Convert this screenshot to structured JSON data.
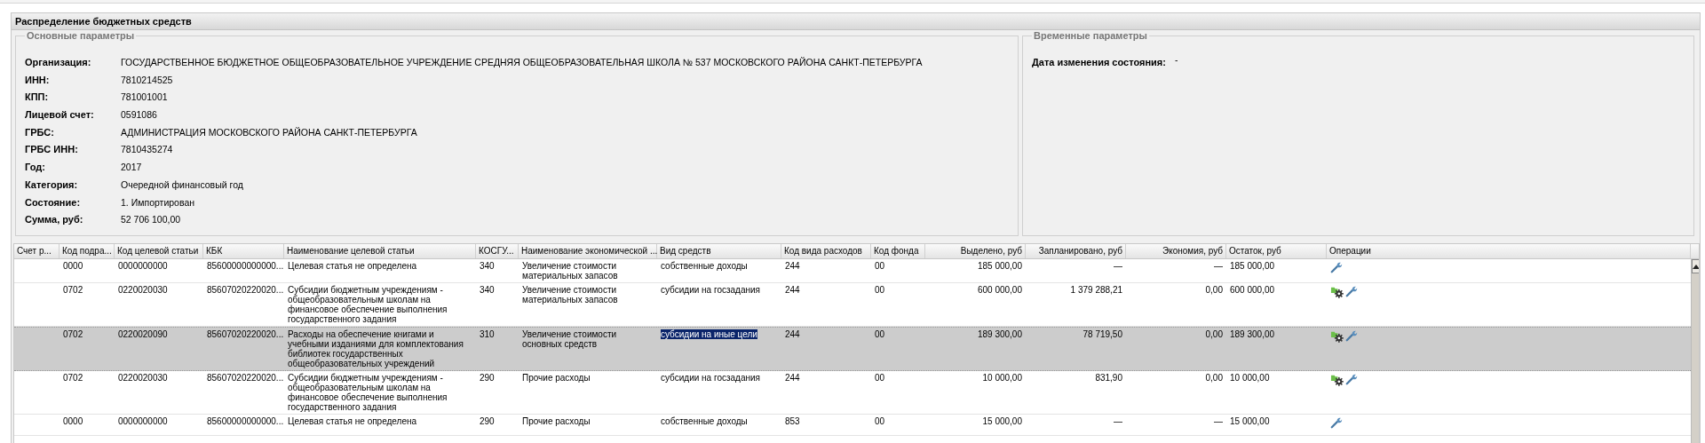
{
  "panel": {
    "title": "Распределение бюджетных средств"
  },
  "main_params": {
    "legend": "Основные параметры",
    "fields": [
      {
        "label": "Организация:",
        "value": "ГОСУДАРСТВЕННОЕ БЮДЖЕТНОЕ ОБЩЕОБРАЗОВАТЕЛЬНОЕ УЧРЕЖДЕНИЕ СРЕДНЯЯ ОБЩЕОБРАЗОВАТЕЛЬНАЯ ШКОЛА № 537 МОСКОВСКОГО РАЙОНА САНКТ-ПЕТЕРБУРГА"
      },
      {
        "label": "ИНН:",
        "value": "7810214525"
      },
      {
        "label": "КПП:",
        "value": "781001001"
      },
      {
        "label": "Лицевой счет:",
        "value": "0591086"
      },
      {
        "label": "ГРБС:",
        "value": "АДМИНИСТРАЦИЯ МОСКОВСКОГО РАЙОНА САНКТ-ПЕТЕРБУРГА"
      },
      {
        "label": "ГРБС ИНН:",
        "value": "7810435274"
      },
      {
        "label": "Год:",
        "value": "2017"
      },
      {
        "label": "Категория:",
        "value": "Очередной финансовый год"
      },
      {
        "label": "Состояние:",
        "value": "1. Импортирован"
      },
      {
        "label": "Сумма, руб:",
        "value": "52 706 100,00"
      }
    ]
  },
  "time_params": {
    "legend": "Временные параметры",
    "fields": [
      {
        "label": "Дата изменения состояния:",
        "value": "-"
      }
    ]
  },
  "table": {
    "columns": [
      "Счет р...",
      "Код подра...",
      "Код целевой статьи",
      "КБК",
      "Наименование целевой статьи",
      "КОСГУ...",
      "Наименование экономической ...",
      "Вид средств",
      "Код вида расходов",
      "Код фонда",
      "Выделено, руб",
      "Запланировано, руб",
      "Экономия, руб",
      "Остаток, руб",
      "Операции"
    ],
    "rows": [
      {
        "selected": false,
        "text_highlighted": false,
        "cells": [
          "",
          "0000",
          "0000000000",
          "85600000000000...",
          "Целевая статья не определена",
          "340",
          "Увеличение стоимости материальных запасов",
          "собственные доходы",
          "244",
          "00",
          "185 000,00",
          "—",
          "—",
          "185 000,00"
        ],
        "operations": [
          {
            "kind": "wrench"
          }
        ]
      },
      {
        "selected": false,
        "text_highlighted": false,
        "cells": [
          "",
          "0702",
          "0220020030",
          "85607020220020...",
          "Субсидии бюджетным учреждениям - общеобразовательным школам на финансовое обеспечение выполнения государственного задания",
          "340",
          "Увеличение стоимости материальных запасов",
          "субсидии на госзадания",
          "244",
          "00",
          "600 000,00",
          "1 379 288,21",
          "0,00",
          "600 000,00"
        ],
        "operations": [
          {
            "kind": "gear"
          },
          {
            "kind": "wrench"
          }
        ]
      },
      {
        "selected": true,
        "text_highlighted": true,
        "cells": [
          "",
          "0702",
          "0220020090",
          "85607020220020...",
          "Расходы на обеспечение книгами и учебными изданиями для комплектования библиотек государственных общеобразовательных учреждений",
          "310",
          "Увеличение стоимости основных средств",
          "субсидии на иные цели",
          "244",
          "00",
          "189 300,00",
          "78 719,50",
          "0,00",
          "189 300,00"
        ],
        "operations": [
          {
            "kind": "gear"
          },
          {
            "kind": "wrench"
          }
        ]
      },
      {
        "selected": false,
        "text_highlighted": false,
        "cells": [
          "",
          "0702",
          "0220020030",
          "85607020220020...",
          "Субсидии бюджетным учреждениям - общеобразовательным школам на финансовое обеспечение выполнения государственного задания",
          "290",
          "Прочие расходы",
          "субсидии на госзадания",
          "244",
          "00",
          "10 000,00",
          "831,90",
          "0,00",
          "10 000,00"
        ],
        "operations": [
          {
            "kind": "gear"
          },
          {
            "kind": "wrench"
          }
        ]
      },
      {
        "selected": false,
        "text_highlighted": false,
        "cells": [
          "",
          "0000",
          "0000000000",
          "85600000000000...",
          "Целевая статья не определена",
          "290",
          "Прочие расходы",
          "собственные доходы",
          "853",
          "00",
          "15 000,00",
          "—",
          "—",
          "15 000,00"
        ],
        "operations": [
          {
            "kind": "wrench"
          }
        ]
      }
    ]
  }
}
